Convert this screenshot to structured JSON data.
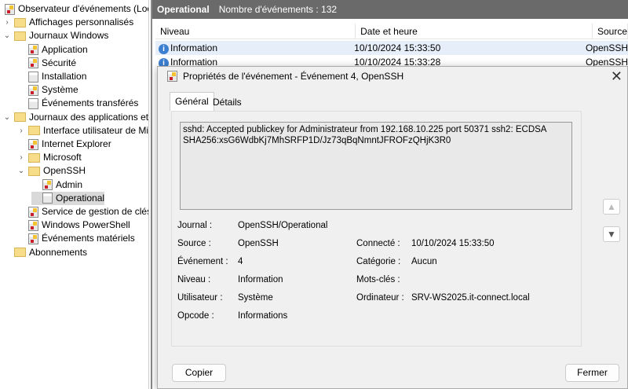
{
  "tree": {
    "items": [
      {
        "label": "Observateur d'événements (Local)",
        "level": 0,
        "chev": "",
        "icon": "log"
      },
      {
        "label": "Affichages personnalisés",
        "level": 1,
        "chev": ">",
        "icon": "folder"
      },
      {
        "label": "Journaux Windows",
        "level": 1,
        "chev": "v",
        "icon": "folder"
      },
      {
        "label": "Application",
        "level": 2,
        "chev": "",
        "icon": "log"
      },
      {
        "label": "Sécurité",
        "level": 2,
        "chev": "",
        "icon": "log"
      },
      {
        "label": "Installation",
        "level": 2,
        "chev": "",
        "icon": "plain"
      },
      {
        "label": "Système",
        "level": 2,
        "chev": "",
        "icon": "log"
      },
      {
        "label": "Événements transférés",
        "level": 2,
        "chev": "",
        "icon": "plain"
      },
      {
        "label": "Journaux des applications et services",
        "level": 1,
        "chev": "v",
        "icon": "folder"
      },
      {
        "label": "Interface utilisateur de Microsoft",
        "level": 2,
        "chev": ">",
        "icon": "folder"
      },
      {
        "label": "Internet Explorer",
        "level": 2,
        "chev": "",
        "icon": "log"
      },
      {
        "label": "Microsoft",
        "level": 2,
        "chev": ">",
        "icon": "folder"
      },
      {
        "label": "OpenSSH",
        "level": 2,
        "chev": "v",
        "icon": "folder"
      },
      {
        "label": "Admin",
        "level": 3,
        "chev": "",
        "icon": "log"
      },
      {
        "label": "Operational",
        "level": 3,
        "chev": "",
        "icon": "plain",
        "selected": true
      },
      {
        "label": "Service de gestion de clés",
        "level": 2,
        "chev": "",
        "icon": "log"
      },
      {
        "label": "Windows PowerShell",
        "level": 2,
        "chev": "",
        "icon": "log"
      },
      {
        "label": "Événements matériels",
        "level": 2,
        "chev": "",
        "icon": "log"
      },
      {
        "label": "Abonnements",
        "level": 1,
        "chev": "",
        "icon": "folder"
      }
    ]
  },
  "header": {
    "log": "Operational",
    "count": "Nombre d'événements : 132"
  },
  "table": {
    "columns": [
      "Niveau",
      "Date et heure",
      "Source"
    ],
    "rows": [
      [
        "Information",
        "10/10/2024 15:33:50",
        "OpenSSH"
      ],
      [
        "Information",
        "10/10/2024 15:33:28",
        "OpenSSH"
      ]
    ]
  },
  "dialog": {
    "title": "Propriétés de l'événement - Événement 4, OpenSSH",
    "tabs": [
      "Général",
      "Détails"
    ],
    "message": "sshd: Accepted publickey for Administrateur from 192.168.10.225 port 50371 ssh2: ECDSA SHA256:xsG6WdbKj7MhSRFP1D/Jz73qBqNmntJFROFzQHjK3R0",
    "fields": {
      "journal": {
        "label": "Journal :",
        "value": "OpenSSH/Operational"
      },
      "source": {
        "label": "Source :",
        "value": "OpenSSH"
      },
      "evenement": {
        "label": "Événement :",
        "value": "4"
      },
      "niveau": {
        "label": "Niveau :",
        "value": "Information"
      },
      "utilisateur": {
        "label": "Utilisateur :",
        "value": "Système"
      },
      "opcode": {
        "label": "Opcode :",
        "value": "Informations"
      },
      "connecte": {
        "label": "Connecté :",
        "value": "10/10/2024 15:33:50"
      },
      "categorie": {
        "label": "Catégorie :",
        "value": "Aucun"
      },
      "motscles": {
        "label": "Mots-clés :",
        "value": ""
      },
      "ordinateur": {
        "label": "Ordinateur :",
        "value": "SRV-WS2025.it-connect.local"
      }
    },
    "copy_label": "Copier",
    "close_label": "Fermer"
  }
}
